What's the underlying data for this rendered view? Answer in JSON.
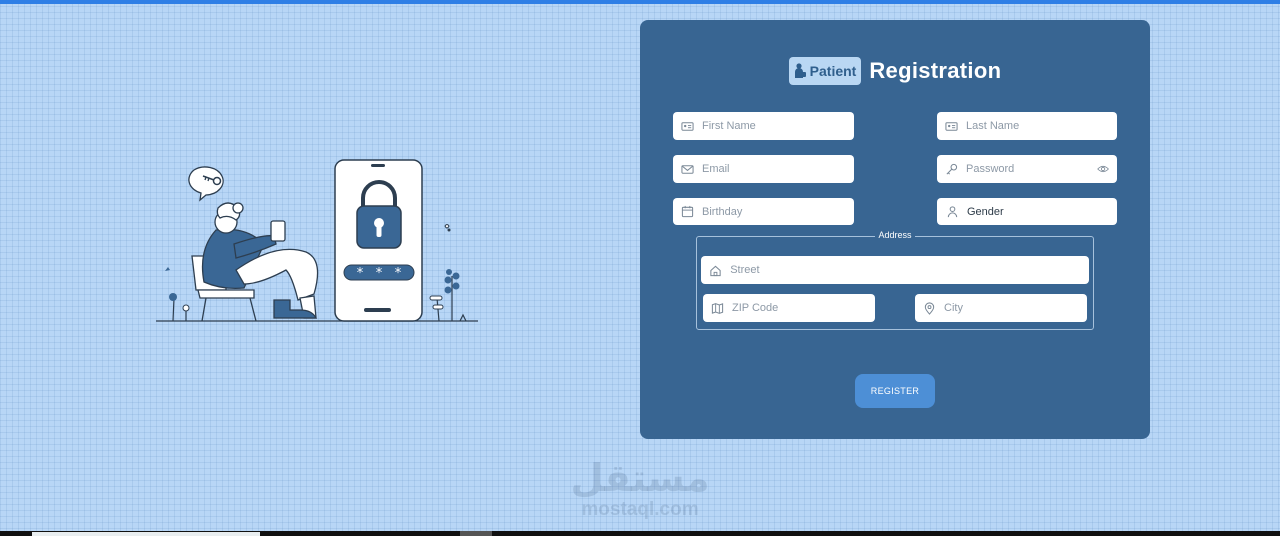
{
  "form": {
    "badge": "Patient",
    "title": "Registration",
    "fields": {
      "first_name": "First Name",
      "last_name": "Last Name",
      "email": "Email",
      "password": "Password",
      "birthday": "Birthday",
      "gender": "Gender"
    },
    "address": {
      "legend": "Address",
      "street": "Street",
      "zip": "ZIP Code",
      "city": "City"
    },
    "register_label": "REGISTER"
  },
  "watermark": {
    "arabic": "مستقل",
    "latin": "mostaql.com"
  },
  "colors": {
    "background": "#b8d6f6",
    "panel": "#386592",
    "button": "#4d8fd6",
    "accent_bar": "#2f7fe6"
  },
  "icons": [
    "id-card-icon",
    "mail-icon",
    "key-icon",
    "eye-icon",
    "calendar-icon",
    "user-icon",
    "home-icon",
    "map-icon",
    "location-pin-icon",
    "person-icon"
  ]
}
